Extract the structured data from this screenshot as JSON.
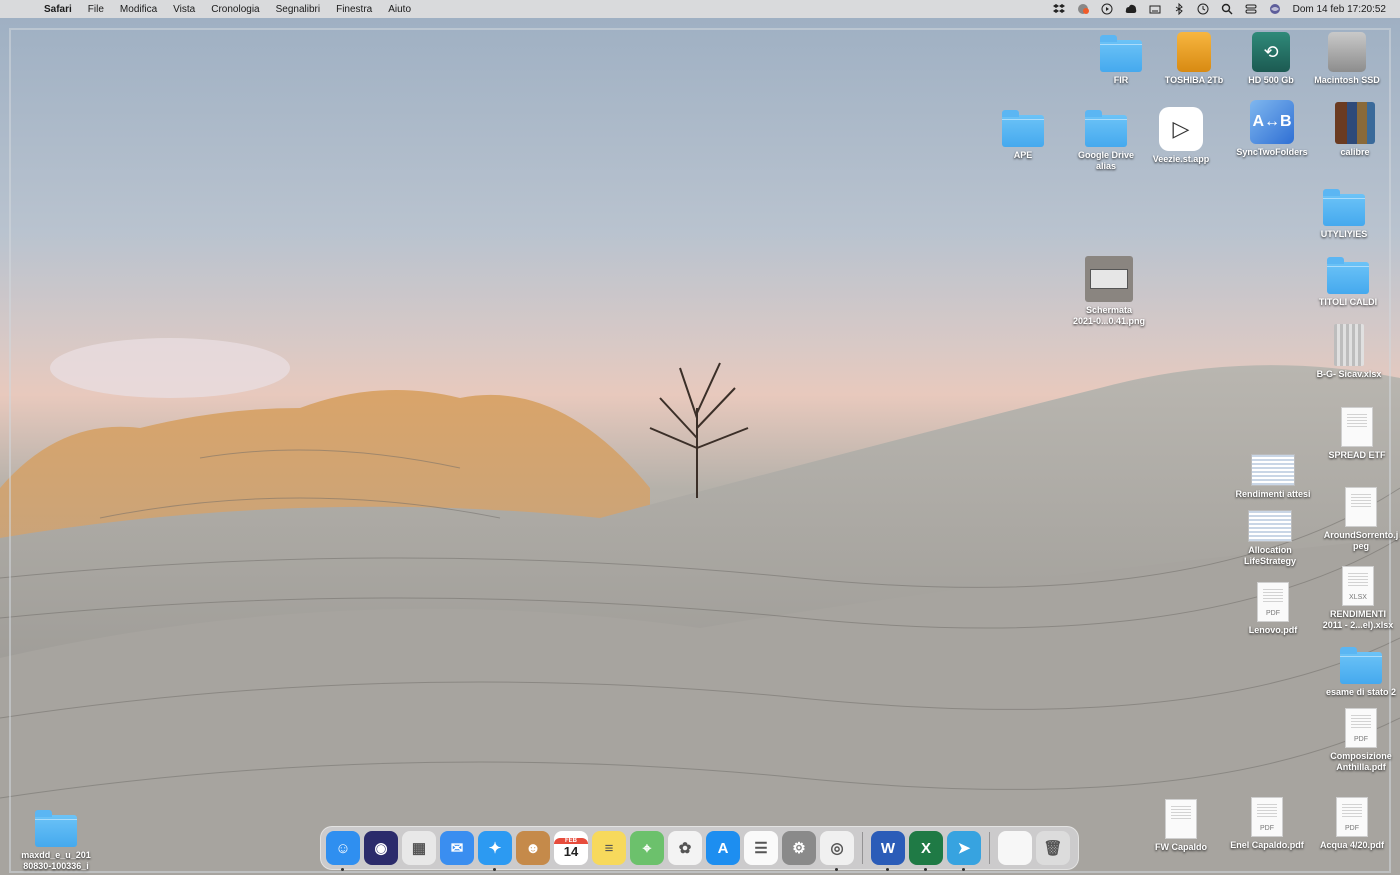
{
  "menubar": {
    "app_name": "Safari",
    "menus": [
      "File",
      "Modifica",
      "Vista",
      "Cronologia",
      "Segnalibri",
      "Finestra",
      "Aiuto"
    ],
    "clock": "Dom 14 feb  17:20:52",
    "status_icons": [
      "dropbox-icon",
      "notification-icon",
      "play-icon",
      "cloud-icon",
      "keyboard-icon",
      "bluetooth-icon",
      "time-machine-icon",
      "search-icon",
      "control-center-icon",
      "siri-icon"
    ]
  },
  "desktop": {
    "icons": [
      {
        "label": "FIR",
        "kind": "folder"
      },
      {
        "label": "TOSHIBA 2Tb",
        "kind": "drive-external"
      },
      {
        "label": "HD 500 Gb",
        "kind": "time-machine-drive"
      },
      {
        "label": "Macintosh SSD",
        "kind": "drive-internal"
      },
      {
        "label": "APE",
        "kind": "folder"
      },
      {
        "label": "Google Drive\nalias",
        "kind": "folder-alias"
      },
      {
        "label": "Veezie.st.app",
        "kind": "app"
      },
      {
        "label": "SyncTwoFolders",
        "kind": "app"
      },
      {
        "label": "calibre",
        "kind": "app"
      },
      {
        "label": "UTYLIYIES",
        "kind": "folder"
      },
      {
        "label": "Schermata\n2021-0...0.41.png",
        "kind": "screenshot"
      },
      {
        "label": "TITOLI CALDI",
        "kind": "folder"
      },
      {
        "label": "B-G- Sicav.xlsx",
        "kind": "archive"
      },
      {
        "label": "SPREAD ETF",
        "kind": "document"
      },
      {
        "label": "Rendimenti attesi",
        "kind": "spreadsheet-thumb"
      },
      {
        "label": "AroundSorrento.j\npeg",
        "kind": "image"
      },
      {
        "label": "Allocation\nLifeStrategy",
        "kind": "document-thumb"
      },
      {
        "label": "RENDIMENTI\n2011 - 2...el).xlsx",
        "kind": "xlsx"
      },
      {
        "label": "Lenovo.pdf",
        "kind": "pdf"
      },
      {
        "label": "esame di stato 2",
        "kind": "folder"
      },
      {
        "label": "Composizione\nAnthilla.pdf",
        "kind": "pdf"
      },
      {
        "label": "FW Capaldo",
        "kind": "document"
      },
      {
        "label": "Enel Capaldo.pdf",
        "kind": "pdf"
      },
      {
        "label": "Acqua 4/20.pdf",
        "kind": "pdf"
      },
      {
        "label": "maxdd_e_u_201\n80830-100336_i",
        "kind": "folder"
      }
    ],
    "glyphs": {
      "pdf": "PDF",
      "xlsx": "XLSX",
      "time_machine": "⟲",
      "veezie": "▷",
      "sync": "A↔B"
    }
  },
  "dock": {
    "apps": [
      {
        "name": "Finder",
        "icon": "finder-icon",
        "color": "#2f8ff0",
        "glyph": "☺",
        "running": true
      },
      {
        "name": "Siri",
        "icon": "siri-icon",
        "color": "#2b2b6b",
        "glyph": "◉",
        "running": false
      },
      {
        "name": "Launchpad",
        "icon": "launchpad-icon",
        "color": "#e8e8e8",
        "glyph": "▦",
        "running": false
      },
      {
        "name": "Mail",
        "icon": "mail-icon",
        "color": "#3a8ef0",
        "glyph": "✉",
        "running": false
      },
      {
        "name": "Safari",
        "icon": "safari-icon",
        "color": "#2c9af2",
        "glyph": "✦",
        "running": true
      },
      {
        "name": "Contacts",
        "icon": "contacts-icon",
        "color": "#c58a4a",
        "glyph": "☻",
        "running": false
      },
      {
        "name": "Calendar",
        "icon": "calendar-icon",
        "color": "#ffffff",
        "glyph": "14",
        "month": "FEB",
        "running": false
      },
      {
        "name": "Notes",
        "icon": "notes-icon",
        "color": "#f7d95c",
        "glyph": "≡",
        "running": false
      },
      {
        "name": "Maps",
        "icon": "maps-icon",
        "color": "#6cc16c",
        "glyph": "⌖",
        "running": false
      },
      {
        "name": "Photos",
        "icon": "photos-icon",
        "color": "#f3f3f3",
        "glyph": "✿",
        "running": false
      },
      {
        "name": "App Store",
        "icon": "app-store-icon",
        "color": "#1d8ef0",
        "glyph": "A",
        "running": false
      },
      {
        "name": "Reminders",
        "icon": "reminders-icon",
        "color": "#fafafa",
        "glyph": "☰",
        "running": false
      },
      {
        "name": "System Preferences",
        "icon": "system-preferences-icon",
        "color": "#8a8a8a",
        "glyph": "⚙",
        "running": false
      },
      {
        "name": "Chrome",
        "icon": "chrome-icon",
        "color": "#f0f0f0",
        "glyph": "◎",
        "running": true
      },
      {
        "name": "Word",
        "icon": "word-icon",
        "color": "#2b5cb8",
        "glyph": "W",
        "running": true
      },
      {
        "name": "Excel",
        "icon": "excel-icon",
        "color": "#1f7a45",
        "glyph": "X",
        "running": true
      },
      {
        "name": "Telegram",
        "icon": "telegram-icon",
        "color": "#37a3e0",
        "glyph": "➤",
        "running": true
      },
      {
        "name": "Documents",
        "icon": "document-stack-icon",
        "color": "#f7f7f7",
        "glyph": "",
        "running": false
      },
      {
        "name": "Trash",
        "icon": "trash-icon",
        "color": "#dcdcdc",
        "glyph": "🗑",
        "running": false
      }
    ]
  }
}
